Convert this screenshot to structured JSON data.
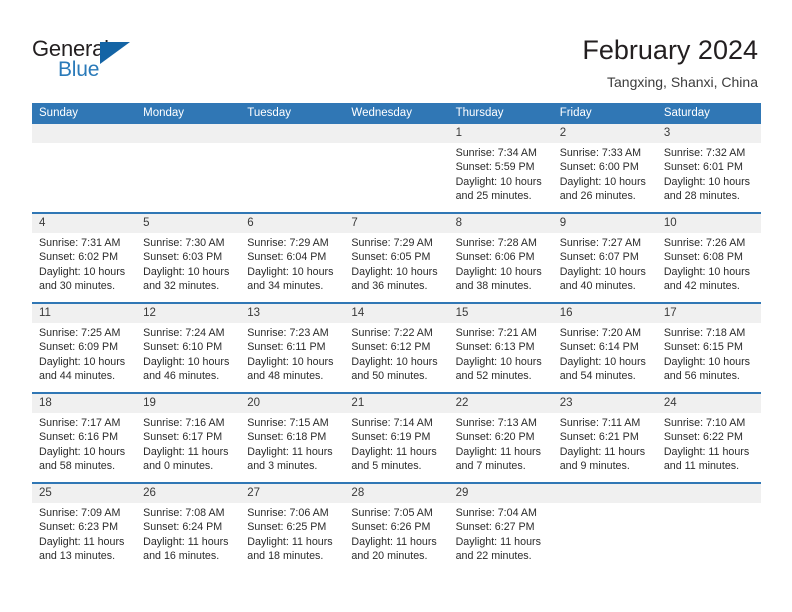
{
  "brand": {
    "name_top": "General",
    "name_bottom": "Blue",
    "triangle_icon": "blue-triangle-logo-mark",
    "accent_color": "#1464a5",
    "text_color": "#231f20"
  },
  "header": {
    "title": "February 2024",
    "subtitle": "Tangxing, Shanxi, China"
  },
  "colors": {
    "header_blue": "#3077b5",
    "date_band_gray": "#f0f0f0",
    "body_text": "#2b2b2b"
  },
  "weekdays": [
    "Sunday",
    "Monday",
    "Tuesday",
    "Wednesday",
    "Thursday",
    "Friday",
    "Saturday"
  ],
  "weeks": [
    {
      "days": [
        {
          "num": "",
          "lines": []
        },
        {
          "num": "",
          "lines": []
        },
        {
          "num": "",
          "lines": []
        },
        {
          "num": "",
          "lines": []
        },
        {
          "num": "1",
          "lines": [
            "Sunrise: 7:34 AM",
            "Sunset: 5:59 PM",
            "Daylight: 10 hours",
            "and 25 minutes."
          ]
        },
        {
          "num": "2",
          "lines": [
            "Sunrise: 7:33 AM",
            "Sunset: 6:00 PM",
            "Daylight: 10 hours",
            "and 26 minutes."
          ]
        },
        {
          "num": "3",
          "lines": [
            "Sunrise: 7:32 AM",
            "Sunset: 6:01 PM",
            "Daylight: 10 hours",
            "and 28 minutes."
          ]
        }
      ]
    },
    {
      "days": [
        {
          "num": "4",
          "lines": [
            "Sunrise: 7:31 AM",
            "Sunset: 6:02 PM",
            "Daylight: 10 hours",
            "and 30 minutes."
          ]
        },
        {
          "num": "5",
          "lines": [
            "Sunrise: 7:30 AM",
            "Sunset: 6:03 PM",
            "Daylight: 10 hours",
            "and 32 minutes."
          ]
        },
        {
          "num": "6",
          "lines": [
            "Sunrise: 7:29 AM",
            "Sunset: 6:04 PM",
            "Daylight: 10 hours",
            "and 34 minutes."
          ]
        },
        {
          "num": "7",
          "lines": [
            "Sunrise: 7:29 AM",
            "Sunset: 6:05 PM",
            "Daylight: 10 hours",
            "and 36 minutes."
          ]
        },
        {
          "num": "8",
          "lines": [
            "Sunrise: 7:28 AM",
            "Sunset: 6:06 PM",
            "Daylight: 10 hours",
            "and 38 minutes."
          ]
        },
        {
          "num": "9",
          "lines": [
            "Sunrise: 7:27 AM",
            "Sunset: 6:07 PM",
            "Daylight: 10 hours",
            "and 40 minutes."
          ]
        },
        {
          "num": "10",
          "lines": [
            "Sunrise: 7:26 AM",
            "Sunset: 6:08 PM",
            "Daylight: 10 hours",
            "and 42 minutes."
          ]
        }
      ]
    },
    {
      "days": [
        {
          "num": "11",
          "lines": [
            "Sunrise: 7:25 AM",
            "Sunset: 6:09 PM",
            "Daylight: 10 hours",
            "and 44 minutes."
          ]
        },
        {
          "num": "12",
          "lines": [
            "Sunrise: 7:24 AM",
            "Sunset: 6:10 PM",
            "Daylight: 10 hours",
            "and 46 minutes."
          ]
        },
        {
          "num": "13",
          "lines": [
            "Sunrise: 7:23 AM",
            "Sunset: 6:11 PM",
            "Daylight: 10 hours",
            "and 48 minutes."
          ]
        },
        {
          "num": "14",
          "lines": [
            "Sunrise: 7:22 AM",
            "Sunset: 6:12 PM",
            "Daylight: 10 hours",
            "and 50 minutes."
          ]
        },
        {
          "num": "15",
          "lines": [
            "Sunrise: 7:21 AM",
            "Sunset: 6:13 PM",
            "Daylight: 10 hours",
            "and 52 minutes."
          ]
        },
        {
          "num": "16",
          "lines": [
            "Sunrise: 7:20 AM",
            "Sunset: 6:14 PM",
            "Daylight: 10 hours",
            "and 54 minutes."
          ]
        },
        {
          "num": "17",
          "lines": [
            "Sunrise: 7:18 AM",
            "Sunset: 6:15 PM",
            "Daylight: 10 hours",
            "and 56 minutes."
          ]
        }
      ]
    },
    {
      "days": [
        {
          "num": "18",
          "lines": [
            "Sunrise: 7:17 AM",
            "Sunset: 6:16 PM",
            "Daylight: 10 hours",
            "and 58 minutes."
          ]
        },
        {
          "num": "19",
          "lines": [
            "Sunrise: 7:16 AM",
            "Sunset: 6:17 PM",
            "Daylight: 11 hours",
            "and 0 minutes."
          ]
        },
        {
          "num": "20",
          "lines": [
            "Sunrise: 7:15 AM",
            "Sunset: 6:18 PM",
            "Daylight: 11 hours",
            "and 3 minutes."
          ]
        },
        {
          "num": "21",
          "lines": [
            "Sunrise: 7:14 AM",
            "Sunset: 6:19 PM",
            "Daylight: 11 hours",
            "and 5 minutes."
          ]
        },
        {
          "num": "22",
          "lines": [
            "Sunrise: 7:13 AM",
            "Sunset: 6:20 PM",
            "Daylight: 11 hours",
            "and 7 minutes."
          ]
        },
        {
          "num": "23",
          "lines": [
            "Sunrise: 7:11 AM",
            "Sunset: 6:21 PM",
            "Daylight: 11 hours",
            "and 9 minutes."
          ]
        },
        {
          "num": "24",
          "lines": [
            "Sunrise: 7:10 AM",
            "Sunset: 6:22 PM",
            "Daylight: 11 hours",
            "and 11 minutes."
          ]
        }
      ]
    },
    {
      "days": [
        {
          "num": "25",
          "lines": [
            "Sunrise: 7:09 AM",
            "Sunset: 6:23 PM",
            "Daylight: 11 hours",
            "and 13 minutes."
          ]
        },
        {
          "num": "26",
          "lines": [
            "Sunrise: 7:08 AM",
            "Sunset: 6:24 PM",
            "Daylight: 11 hours",
            "and 16 minutes."
          ]
        },
        {
          "num": "27",
          "lines": [
            "Sunrise: 7:06 AM",
            "Sunset: 6:25 PM",
            "Daylight: 11 hours",
            "and 18 minutes."
          ]
        },
        {
          "num": "28",
          "lines": [
            "Sunrise: 7:05 AM",
            "Sunset: 6:26 PM",
            "Daylight: 11 hours",
            "and 20 minutes."
          ]
        },
        {
          "num": "29",
          "lines": [
            "Sunrise: 7:04 AM",
            "Sunset: 6:27 PM",
            "Daylight: 11 hours",
            "and 22 minutes."
          ]
        },
        {
          "num": "",
          "lines": []
        },
        {
          "num": "",
          "lines": []
        }
      ]
    }
  ]
}
